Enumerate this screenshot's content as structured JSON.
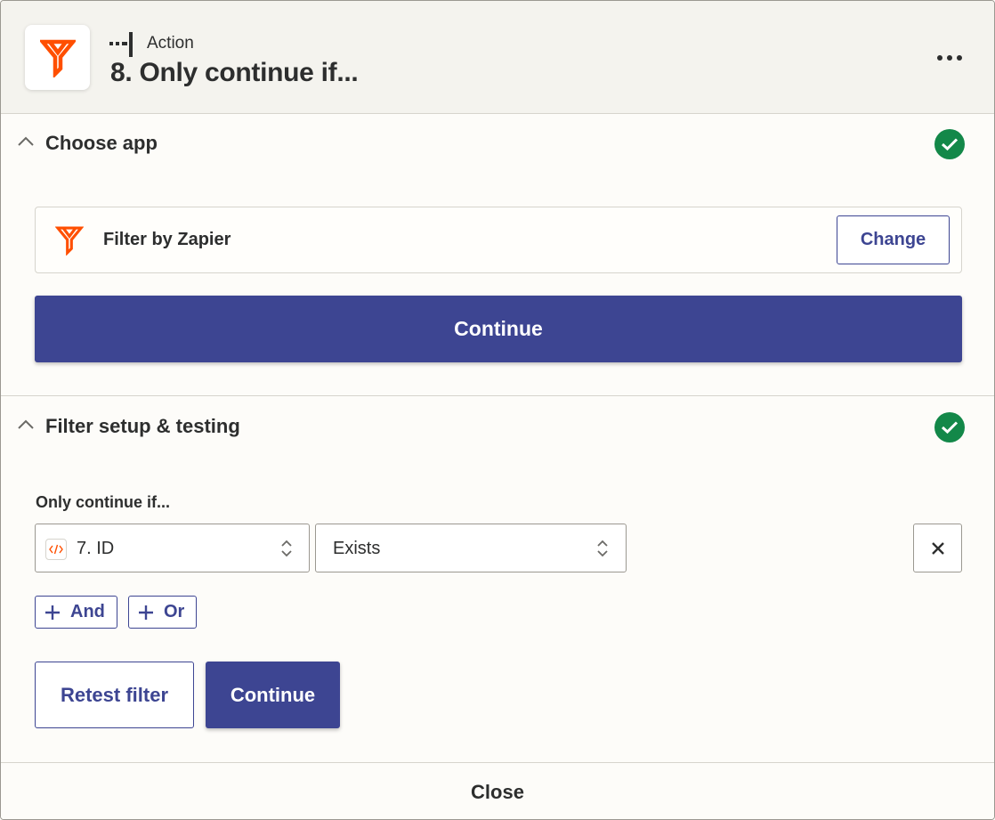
{
  "header": {
    "step_type": "Action",
    "title": "8. Only continue if...",
    "app_icon": "filter-funnel-icon",
    "more_icon": "more-dots-icon"
  },
  "choose_app": {
    "title": "Choose app",
    "status": "complete",
    "app_name": "Filter by Zapier",
    "change_label": "Change",
    "continue_label": "Continue"
  },
  "filter_setup": {
    "title": "Filter setup & testing",
    "status": "complete",
    "condition_label": "Only continue if...",
    "field_value": "7. ID",
    "field_icon": "code-icon",
    "operator_value": "Exists",
    "and_label": "And",
    "or_label": "Or",
    "retest_label": "Retest filter",
    "continue_label": "Continue"
  },
  "footer": {
    "close_label": "Close"
  },
  "colors": {
    "accent": "#3d4592",
    "brand_orange": "#ff4f00",
    "success": "#138849",
    "header_bg": "#f4f3ee",
    "page_bg": "#fdfcf9"
  }
}
